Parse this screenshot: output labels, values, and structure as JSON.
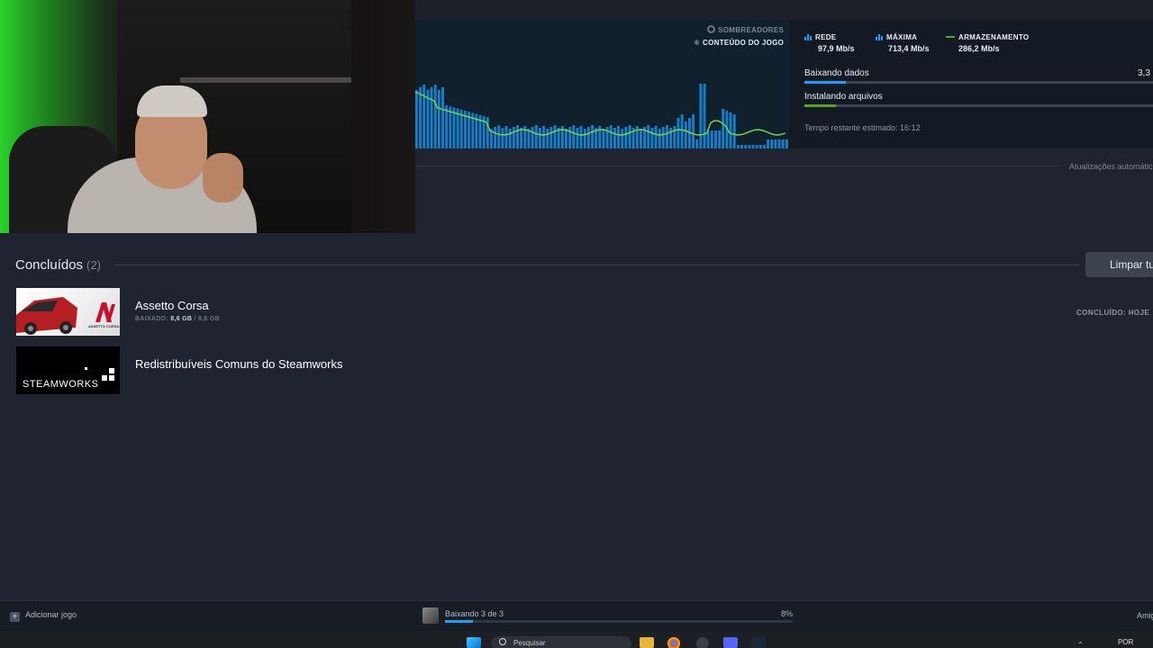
{
  "header": {
    "content_type": {
      "shaders_label": "SOMBREADORES",
      "game_content_label": "CONTEÚDO DO JOGO"
    },
    "stats": [
      {
        "label": "REDE",
        "value": "97,9 Mb/s",
        "color": "#1a9fff"
      },
      {
        "label": "MÁXIMA",
        "value": "713,4 Mb/s",
        "color": "#1a9fff"
      },
      {
        "label": "ARMAZENAMENTO",
        "value": "286,2 Mb/s",
        "color": "#5ba32b"
      }
    ],
    "downloading_label": "Baixando dados",
    "downloading_size": "3,3",
    "downloading_progress": 0.12,
    "installing_label": "Instalando arquivos",
    "installing_progress": 0.09,
    "time_remaining": "Tempo restante estimado: 16:12",
    "auto_updates": "Atualizações automátic"
  },
  "completed": {
    "title": "Concluídos",
    "count": "(2)",
    "clear_button": "Limpar tu",
    "items": [
      {
        "name": "Assetto Corsa",
        "meta_label": "BAIXADO:",
        "meta_downloaded": "8,6 GB",
        "meta_total": "/ 8,6 GB",
        "status": "CONCLUÍDO: HOJE",
        "logo_text": "ASSETTO CORSA"
      },
      {
        "name": "Redistribuíveis Comuns do Steamworks",
        "logo_text": "STEAMWORKS"
      }
    ]
  },
  "bottom": {
    "add_game": "Adicionar jogo",
    "add_icon": "+",
    "download_status": "Baixando 3 de 3",
    "download_percent": "8%",
    "download_progress": 0.08,
    "friends": "Amig"
  },
  "taskbar": {
    "search_placeholder": "Pesquisar",
    "language": "POR"
  },
  "graph": {
    "network_color": "#1a9fff",
    "disk_color": "#5ba32b"
  }
}
